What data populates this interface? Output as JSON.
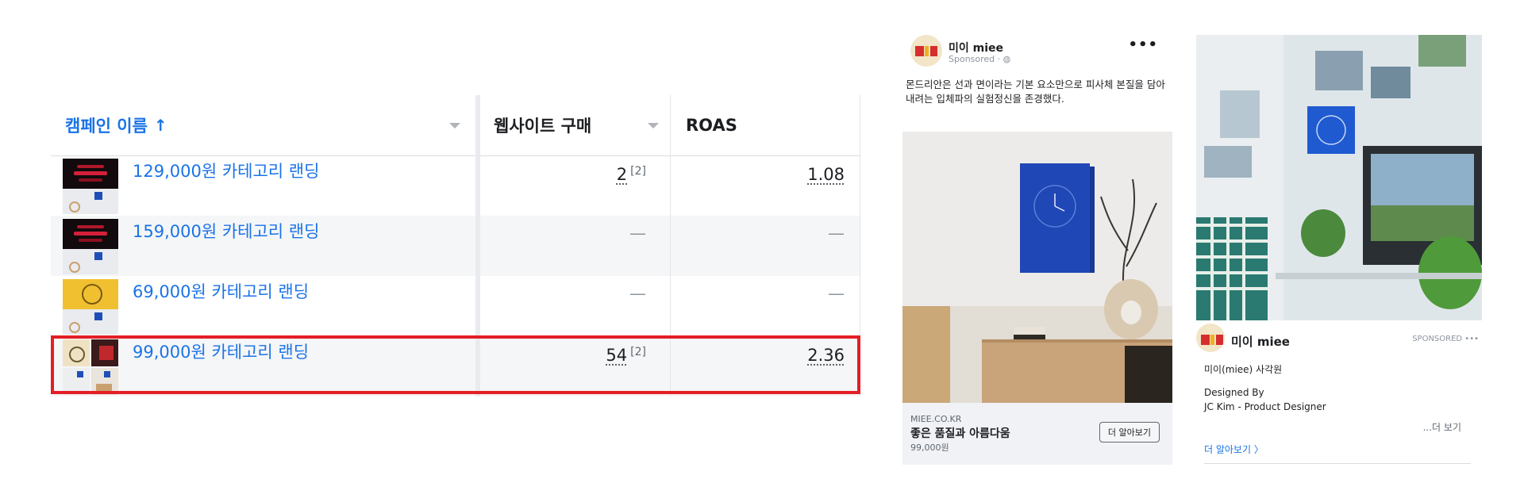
{
  "table": {
    "headers": {
      "name": "캠페인 이름",
      "name_sort": "↑",
      "purchases": "웹사이트 구매",
      "roas": "ROAS"
    },
    "rows": [
      {
        "name": "129,000원 카테고리 랜딩",
        "purchases": "2",
        "purchases_note": "[2]",
        "roas": "1.08"
      },
      {
        "name": "159,000원 카테고리 랜딩",
        "purchases": "—",
        "roas": "—"
      },
      {
        "name": "69,000원 카테고리 랜딩",
        "purchases": "—",
        "roas": "—"
      },
      {
        "name": "99,000원 카테고리 랜딩",
        "purchases": "54",
        "purchases_note": "[2]",
        "roas": "2.36"
      }
    ],
    "highlight_color": "#e41e26"
  },
  "ad1": {
    "brand": "미이 miee",
    "sponsored": "Sponsored · ",
    "body": "몬드리안은 선과 면이라는 기본 요소만으로 피사체 본질을 담아내려는 입체파의 실험정신을 존경했다.",
    "domain": "MIEE.CO.KR",
    "title": "좋은 품질과 아름다움",
    "price": "99,000원",
    "cta": "더 알아보기"
  },
  "ad2": {
    "brand": "미이 miee",
    "sponsored": "SPONSORED •••",
    "line1": "미이(miee) 사각원",
    "line2": "Designed By",
    "line3": "JC Kim - Product Designer",
    "more": "...더 보기",
    "learn_more": "더 알아보기 〉"
  },
  "colors": {
    "link": "#1a73e8",
    "clock_blue": "#1e4fb8"
  }
}
